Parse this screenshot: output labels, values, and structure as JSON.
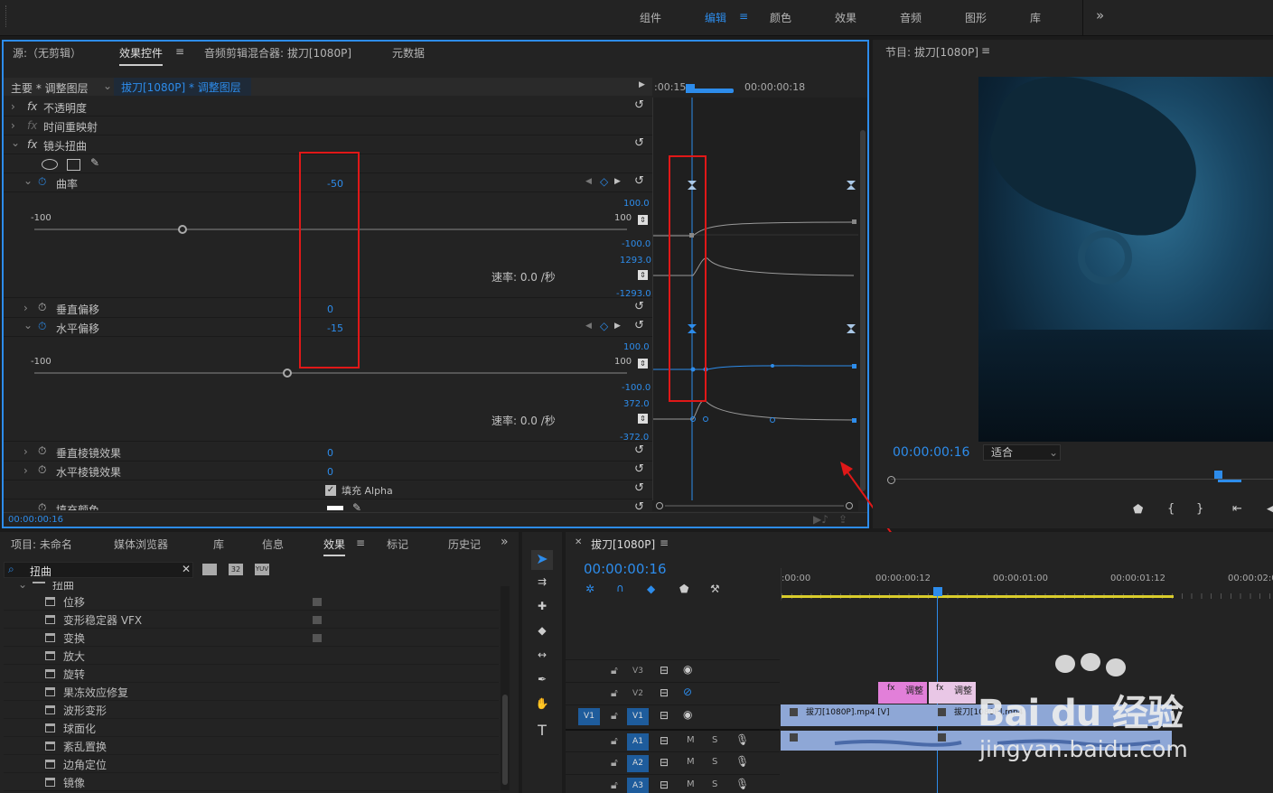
{
  "workspaces": {
    "items": [
      "组件",
      "编辑",
      "颜色",
      "效果",
      "音频",
      "图形",
      "库"
    ],
    "more": "»"
  },
  "effect_controls": {
    "tabs": [
      "源:（无剪辑）",
      "效果控件",
      "音频剪辑混合器: 拔刀[1080P]",
      "元数据"
    ],
    "menu_icon": "≡",
    "master": "主要 * 调整图层",
    "clip": "拔刀[1080P] * 调整图层",
    "tc_left": ":00:15",
    "tc_right": "00:00:00:18",
    "rows": {
      "opacity": "不透明度",
      "time_remap": "时间重映射",
      "lens_distort": "镜头扭曲",
      "curvature": "曲率",
      "curvature_val": "-50",
      "min": "-100",
      "max": "100",
      "g_top1": "100.0",
      "g_bot1": "-100.0",
      "g_top2": "1293.0",
      "g_bot2": "-1293.0",
      "rate": "速率: 0.0 /秒",
      "vdecenter": "垂直偏移",
      "vdecenter_val": "0",
      "hdecenter": "水平偏移",
      "hdecenter_val": "-15",
      "g_top3": "100.0",
      "g_bot3": "-100.0",
      "g_top4": "372.0",
      "g_bot4": "-372.0",
      "rate2": "速率: 0.0 /秒",
      "vprism": "垂直棱镜效果",
      "vprism_val": "0",
      "hprism": "水平棱镜效果",
      "hprism_val": "0",
      "fill_alpha": "填充 Alpha",
      "fill_color": "填充颜色"
    },
    "timecode": "00:00:00:16"
  },
  "program": {
    "title": "节目: 拔刀[1080P]",
    "timecode": "00:00:00:16",
    "fit": "适合"
  },
  "project": {
    "tabs": [
      "项目: 未命名",
      "媒体浏览器",
      "库",
      "信息",
      "效果",
      "标记",
      "历史记"
    ],
    "search": "扭曲",
    "folder": "扭曲",
    "items": [
      "位移",
      "变形稳定器 VFX",
      "变换",
      "放大",
      "旋转",
      "果冻效应修复",
      "波形变形",
      "球面化",
      "紊乱置换",
      "边角定位",
      "镜像"
    ],
    "badges": [
      "32",
      "YUV"
    ]
  },
  "timeline": {
    "title": "拔刀[1080P]",
    "timecode": "00:00:00:16",
    "ruler": [
      ":00:00",
      "00:00:00:12",
      "00:00:01:00",
      "00:00:01:12",
      "00:00:02:0"
    ],
    "tracks": [
      "V3",
      "V2",
      "V1",
      "A1",
      "A2",
      "A3"
    ],
    "src": [
      "V1",
      "A1"
    ],
    "clip_v1": "拔刀[1080P].mp4 [V]",
    "clip_v1b": "拔刀[1080P].mp4",
    "clip_v2a": "调整",
    "clip_v2b": "调整",
    "m": "M",
    "s": "S"
  },
  "watermark": {
    "brand": "Bai du 经验",
    "url": "jingyan.baidu.com"
  },
  "colors": {
    "accent": "#2d8ceb",
    "annotation": "#e01818"
  }
}
